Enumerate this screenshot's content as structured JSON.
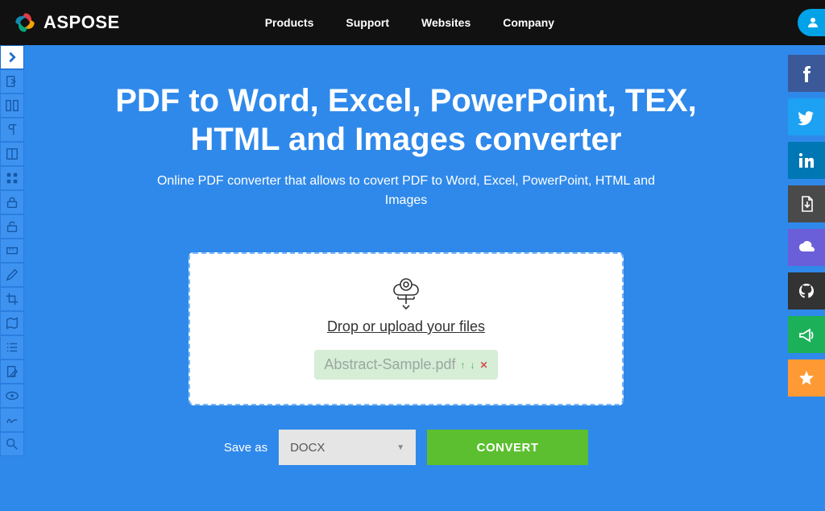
{
  "header": {
    "brand": "ASPOSE",
    "nav": [
      "Products",
      "Support",
      "Websites",
      "Company"
    ]
  },
  "left_tools": [
    "chevron-right",
    "exit",
    "columns",
    "paragraph",
    "book",
    "grid",
    "lock",
    "unlock",
    "ruler",
    "pencil",
    "crop",
    "map",
    "list",
    "edit-doc",
    "eye",
    "sign",
    "search-zoom"
  ],
  "right_social": [
    {
      "name": "facebook",
      "class": "fb"
    },
    {
      "name": "twitter",
      "class": "tw"
    },
    {
      "name": "linkedin",
      "class": "in"
    },
    {
      "name": "pdf",
      "class": "pdf"
    },
    {
      "name": "cloud",
      "class": "cloud"
    },
    {
      "name": "github",
      "class": "gh"
    },
    {
      "name": "megaphone",
      "class": "mega"
    },
    {
      "name": "star",
      "class": "star"
    }
  ],
  "main": {
    "title": "PDF to Word, Excel, PowerPoint, TEX, HTML and Images converter",
    "subtitle": "Online PDF converter that allows to covert PDF to Word, Excel, PowerPoint, HTML and Images",
    "upload_label": "Drop or upload your files",
    "file_name": "Abstract-Sample.pdf",
    "save_as_label": "Save as",
    "format_selected": "DOCX",
    "convert_label": "CONVERT"
  }
}
